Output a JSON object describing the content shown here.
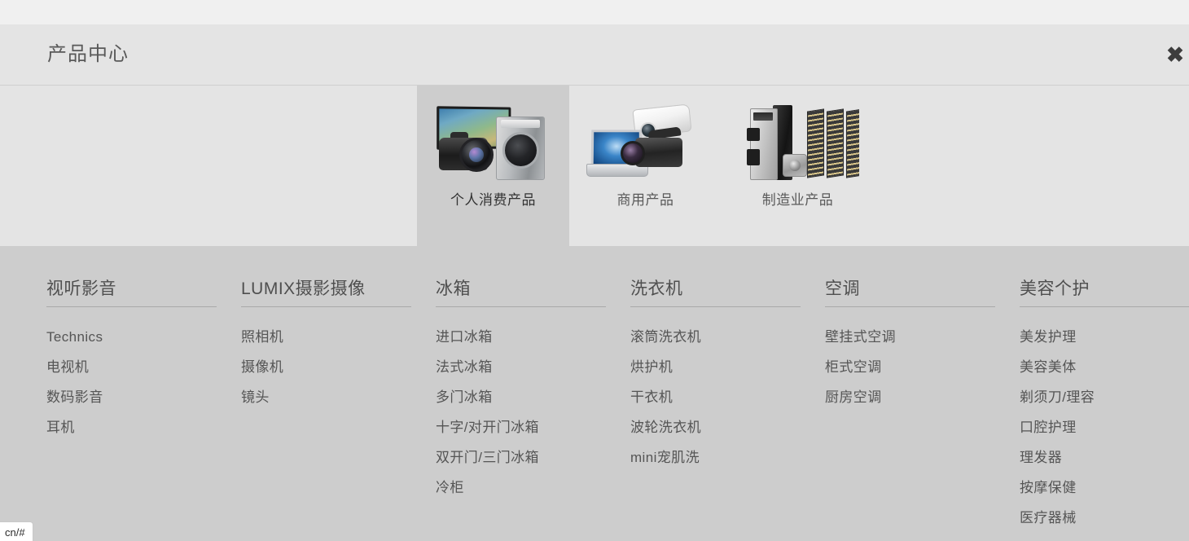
{
  "panel": {
    "title": "产品中心",
    "close_label": "✖"
  },
  "tabs": [
    {
      "label": "个人消费产品",
      "selected": true,
      "image": "consumer-products-photo"
    },
    {
      "label": "商用产品",
      "selected": false,
      "image": "business-products-photo"
    },
    {
      "label": "制造业产品",
      "selected": false,
      "image": "manufacturing-products-photo"
    }
  ],
  "columns": [
    {
      "heading": "视听影音",
      "items": [
        "Technics",
        "电视机",
        "数码影音",
        "耳机"
      ]
    },
    {
      "heading": "LUMIX摄影摄像",
      "items": [
        "照相机",
        "摄像机",
        "镜头"
      ]
    },
    {
      "heading": "冰箱",
      "items": [
        "进口冰箱",
        "法式冰箱",
        "多门冰箱",
        "十字/对开门冰箱",
        "双开门/三门冰箱",
        "冷柜"
      ]
    },
    {
      "heading": "洗衣机",
      "items": [
        "滚筒洗衣机",
        "烘护机",
        "干衣机",
        "波轮洗衣机",
        "mini宠肌洗"
      ]
    },
    {
      "heading": "空调",
      "items": [
        "壁挂式空调",
        "柜式空调",
        "厨房空调"
      ]
    },
    {
      "heading": "美容个护",
      "items": [
        "美发护理",
        "美容美体",
        "剃须刀/理容",
        "口腔护理",
        "理发器",
        "按摩保健",
        "医疗器械"
      ]
    }
  ],
  "status_bar": {
    "url": "cn/#"
  },
  "colors": {
    "page_behind": "#f0f0f0",
    "panel_bg": "#e4e4e4",
    "category_bg": "#cdcdcd",
    "selected_tab_bg": "#cdcdcd",
    "text_primary": "#4f4f4f",
    "text_link": "#555555",
    "divider": "#a9a9a9"
  }
}
